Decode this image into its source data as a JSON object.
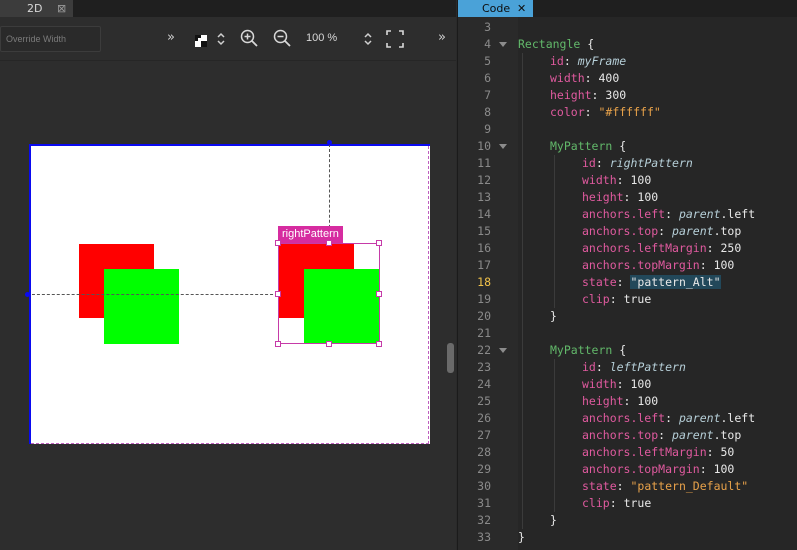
{
  "left_panel": {
    "tab_label": "2D",
    "tab_close": "⊠",
    "override_width_placeholder": "Override Width",
    "toolbar_more_left": "»",
    "zoom_level": "100 %",
    "toolbar_more_right": "»"
  },
  "canvas": {
    "selection_label": "rightPattern"
  },
  "right_panel": {
    "tab_label": "Code",
    "tab_close": "✕"
  },
  "editor": {
    "current_line": 18,
    "lines": [
      {
        "n": 3,
        "fold": false,
        "indent": 0,
        "tokens": []
      },
      {
        "n": 4,
        "fold": true,
        "indent": 0,
        "tokens": [
          {
            "t": "type",
            "v": "Rectangle"
          },
          {
            "t": "punc",
            "v": " {"
          }
        ]
      },
      {
        "n": 5,
        "fold": false,
        "indent": 1,
        "tokens": [
          {
            "t": "prop",
            "v": "id"
          },
          {
            "t": "punc",
            "v": ": "
          },
          {
            "t": "id",
            "v": "myFrame"
          }
        ]
      },
      {
        "n": 6,
        "fold": false,
        "indent": 1,
        "tokens": [
          {
            "t": "prop",
            "v": "width"
          },
          {
            "t": "punc",
            "v": ": "
          },
          {
            "t": "num",
            "v": "400"
          }
        ]
      },
      {
        "n": 7,
        "fold": false,
        "indent": 1,
        "tokens": [
          {
            "t": "prop",
            "v": "height"
          },
          {
            "t": "punc",
            "v": ": "
          },
          {
            "t": "num",
            "v": "300"
          }
        ]
      },
      {
        "n": 8,
        "fold": false,
        "indent": 1,
        "tokens": [
          {
            "t": "prop",
            "v": "color"
          },
          {
            "t": "punc",
            "v": ": "
          },
          {
            "t": "str",
            "v": "\"#ffffff\""
          }
        ]
      },
      {
        "n": 9,
        "fold": false,
        "indent": 1,
        "tokens": []
      },
      {
        "n": 10,
        "fold": true,
        "indent": 1,
        "tokens": [
          {
            "t": "type",
            "v": "MyPattern"
          },
          {
            "t": "punc",
            "v": " {"
          }
        ]
      },
      {
        "n": 11,
        "fold": false,
        "indent": 2,
        "tokens": [
          {
            "t": "prop",
            "v": "id"
          },
          {
            "t": "punc",
            "v": ": "
          },
          {
            "t": "id",
            "v": "rightPattern"
          }
        ]
      },
      {
        "n": 12,
        "fold": false,
        "indent": 2,
        "tokens": [
          {
            "t": "prop",
            "v": "width"
          },
          {
            "t": "punc",
            "v": ": "
          },
          {
            "t": "num",
            "v": "100"
          }
        ]
      },
      {
        "n": 13,
        "fold": false,
        "indent": 2,
        "tokens": [
          {
            "t": "prop",
            "v": "height"
          },
          {
            "t": "punc",
            "v": ": "
          },
          {
            "t": "num",
            "v": "100"
          }
        ]
      },
      {
        "n": 14,
        "fold": false,
        "indent": 2,
        "tokens": [
          {
            "t": "prop",
            "v": "anchors.left"
          },
          {
            "t": "punc",
            "v": ": "
          },
          {
            "t": "id",
            "v": "parent"
          },
          {
            "t": "punc",
            "v": ".left"
          }
        ]
      },
      {
        "n": 15,
        "fold": false,
        "indent": 2,
        "tokens": [
          {
            "t": "prop",
            "v": "anchors.top"
          },
          {
            "t": "punc",
            "v": ": "
          },
          {
            "t": "id",
            "v": "parent"
          },
          {
            "t": "punc",
            "v": ".top"
          }
        ]
      },
      {
        "n": 16,
        "fold": false,
        "indent": 2,
        "tokens": [
          {
            "t": "prop",
            "v": "anchors.leftMargin"
          },
          {
            "t": "punc",
            "v": ": "
          },
          {
            "t": "num",
            "v": "250"
          }
        ]
      },
      {
        "n": 17,
        "fold": false,
        "indent": 2,
        "tokens": [
          {
            "t": "prop",
            "v": "anchors.topMargin"
          },
          {
            "t": "punc",
            "v": ": "
          },
          {
            "t": "num",
            "v": "100"
          }
        ]
      },
      {
        "n": 18,
        "fold": false,
        "indent": 2,
        "tokens": [
          {
            "t": "prop",
            "v": "state"
          },
          {
            "t": "punc",
            "v": ": "
          },
          {
            "t": "strhl",
            "v": "\"pattern_Alt\""
          }
        ]
      },
      {
        "n": 19,
        "fold": false,
        "indent": 2,
        "tokens": [
          {
            "t": "prop",
            "v": "clip"
          },
          {
            "t": "punc",
            "v": ": "
          },
          {
            "t": "num",
            "v": "true"
          }
        ]
      },
      {
        "n": 20,
        "fold": false,
        "indent": 1,
        "tokens": [
          {
            "t": "punc",
            "v": "}"
          }
        ]
      },
      {
        "n": 21,
        "fold": false,
        "indent": 1,
        "tokens": []
      },
      {
        "n": 22,
        "fold": true,
        "indent": 1,
        "tokens": [
          {
            "t": "type",
            "v": "MyPattern"
          },
          {
            "t": "punc",
            "v": " {"
          }
        ]
      },
      {
        "n": 23,
        "fold": false,
        "indent": 2,
        "tokens": [
          {
            "t": "prop",
            "v": "id"
          },
          {
            "t": "punc",
            "v": ": "
          },
          {
            "t": "id",
            "v": "leftPattern"
          }
        ]
      },
      {
        "n": 24,
        "fold": false,
        "indent": 2,
        "tokens": [
          {
            "t": "prop",
            "v": "width"
          },
          {
            "t": "punc",
            "v": ": "
          },
          {
            "t": "num",
            "v": "100"
          }
        ]
      },
      {
        "n": 25,
        "fold": false,
        "indent": 2,
        "tokens": [
          {
            "t": "prop",
            "v": "height"
          },
          {
            "t": "punc",
            "v": ": "
          },
          {
            "t": "num",
            "v": "100"
          }
        ]
      },
      {
        "n": 26,
        "fold": false,
        "indent": 2,
        "tokens": [
          {
            "t": "prop",
            "v": "anchors.left"
          },
          {
            "t": "punc",
            "v": ": "
          },
          {
            "t": "id",
            "v": "parent"
          },
          {
            "t": "punc",
            "v": ".left"
          }
        ]
      },
      {
        "n": 27,
        "fold": false,
        "indent": 2,
        "tokens": [
          {
            "t": "prop",
            "v": "anchors.top"
          },
          {
            "t": "punc",
            "v": ": "
          },
          {
            "t": "id",
            "v": "parent"
          },
          {
            "t": "punc",
            "v": ".top"
          }
        ]
      },
      {
        "n": 28,
        "fold": false,
        "indent": 2,
        "tokens": [
          {
            "t": "prop",
            "v": "anchors.leftMargin"
          },
          {
            "t": "punc",
            "v": ": "
          },
          {
            "t": "num",
            "v": "50"
          }
        ]
      },
      {
        "n": 29,
        "fold": false,
        "indent": 2,
        "tokens": [
          {
            "t": "prop",
            "v": "anchors.topMargin"
          },
          {
            "t": "punc",
            "v": ": "
          },
          {
            "t": "num",
            "v": "100"
          }
        ]
      },
      {
        "n": 30,
        "fold": false,
        "indent": 2,
        "tokens": [
          {
            "t": "prop",
            "v": "state"
          },
          {
            "t": "punc",
            "v": ": "
          },
          {
            "t": "str",
            "v": "\"pattern_Default\""
          }
        ]
      },
      {
        "n": 31,
        "fold": false,
        "indent": 2,
        "tokens": [
          {
            "t": "prop",
            "v": "clip"
          },
          {
            "t": "punc",
            "v": ": "
          },
          {
            "t": "num",
            "v": "true"
          }
        ]
      },
      {
        "n": 32,
        "fold": false,
        "indent": 1,
        "tokens": [
          {
            "t": "punc",
            "v": "}"
          }
        ]
      },
      {
        "n": 33,
        "fold": false,
        "indent": 0,
        "tokens": [
          {
            "t": "punc",
            "v": "}"
          }
        ]
      }
    ]
  },
  "colors": {
    "accent_tab": "#4aa2d8",
    "selection": "#c63aa8",
    "frame_border": "#0a0af0",
    "red_rect": "#ff0000",
    "green_rect": "#00ff00",
    "current_line_number": "#f0c14a"
  },
  "icons": {
    "checker": "checkerboard-icon",
    "updown": "updown-arrow-icon",
    "zoom_in": "zoom-in-icon",
    "zoom_out": "zoom-out-icon",
    "fit": "fit-screen-icon"
  }
}
